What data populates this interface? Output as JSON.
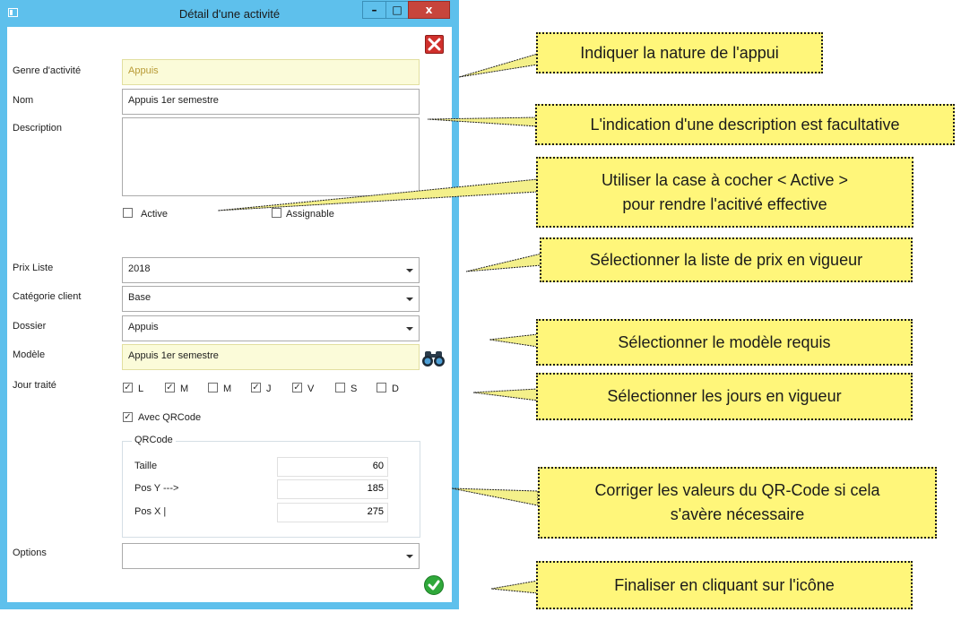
{
  "window": {
    "title": "Détail d'une activité",
    "min_glyph": "–",
    "max_glyph": "□",
    "close_glyph": "x"
  },
  "form": {
    "genre_label": "Genre d'activité",
    "genre_value": "Appuis",
    "nom_label": "Nom",
    "nom_value": "Appuis 1er semestre",
    "description_label": "Description",
    "description_value": "",
    "active_label": "Active",
    "active_checked": false,
    "assignable_label": "Assignable",
    "assignable_checked": false,
    "prix_label": "Prix Liste",
    "prix_value": "2018",
    "categorie_label": "Catégorie client",
    "categorie_value": "Base",
    "dossier_label": "Dossier",
    "dossier_value": "Appuis",
    "modele_label": "Modèle",
    "modele_value": "Appuis 1er semestre",
    "jour_label": "Jour traité",
    "days": [
      {
        "label": "L",
        "checked": true
      },
      {
        "label": "M",
        "checked": true
      },
      {
        "label": "M",
        "checked": false
      },
      {
        "label": "J",
        "checked": true
      },
      {
        "label": "V",
        "checked": true
      },
      {
        "label": "S",
        "checked": false
      },
      {
        "label": "D",
        "checked": false
      }
    ],
    "qrcode_toggle_label": "Avec QRCode",
    "qrcode_toggle_checked": true,
    "qrcode_group_title": "QRCode",
    "taille_label": "Taille",
    "taille_value": "60",
    "posy_label": "Pos Y --->",
    "posy_value": "185",
    "posx_label": "Pos X |",
    "posx_value": "275",
    "options_label": "Options",
    "options_value": ""
  },
  "icons": {
    "close": "close-icon",
    "validate": "checkmark-icon",
    "search": "binoculars-icon"
  },
  "callouts": {
    "c1": "Indiquer la nature de l'appui",
    "c2": "L'indication d'une description est facultative",
    "c3_line1": "Utiliser la case à cocher < Active >",
    "c3_line2": "pour rendre l'acitivé effective",
    "c4": "Sélectionner la liste de prix en vigueur",
    "c5": "Sélectionner le modèle requis",
    "c6": "Sélectionner les jours en vigueur",
    "c7_line1": "Corriger les valeurs du QR-Code si cela",
    "c7_line2": "s'avère nécessaire",
    "c8": "Finaliser en cliquant sur l'icône"
  },
  "colors": {
    "window_frame": "#5ec0ec",
    "readonly_bg": "#fbfbd9",
    "callout_bg": "#fff67a",
    "close_red": "#d0302c",
    "ok_green": "#2fa83a"
  }
}
